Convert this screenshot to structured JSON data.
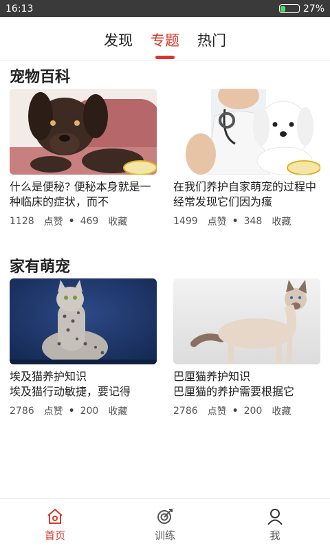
{
  "status_bar": {
    "time": "16:13",
    "battery": "27%",
    "battery_level": 0.27
  },
  "tabs": [
    {
      "label": "发现",
      "active": false
    },
    {
      "label": "专题",
      "active": true
    },
    {
      "label": "热门",
      "active": false
    }
  ],
  "sections": [
    {
      "title": "宠物百科",
      "cards": [
        {
          "image": "brown-dog-on-cushion",
          "text": "什么是便秘? 便秘本身就是一种临床的症状，而不",
          "likes": "1128",
          "like_label": "点赞",
          "favorites": "469",
          "fav_label": "收藏"
        },
        {
          "image": "vet-with-white-puppy",
          "text": "在我们养护自家萌宠的过程中经常发现它们因为瘙",
          "likes": "1499",
          "like_label": "点赞",
          "favorites": "348",
          "fav_label": "收藏"
        }
      ]
    },
    {
      "title": "家有萌宠",
      "cards": [
        {
          "image": "egyptian-mau-cat",
          "text": "埃及猫养护知识\n埃及猫行动敏捷，要记得",
          "likes": "2786",
          "like_label": "点赞",
          "favorites": "200",
          "fav_label": "收藏"
        },
        {
          "image": "balinese-cat",
          "text": "巴厘猫养护知识\n巴厘猫的养护需要根据它",
          "likes": "2786",
          "like_label": "点赞",
          "favorites": "200",
          "fav_label": "收藏"
        }
      ]
    }
  ],
  "bottom_nav": [
    {
      "label": "首页",
      "icon": "home-icon",
      "active": true
    },
    {
      "label": "训练",
      "icon": "target-icon",
      "active": false
    },
    {
      "label": "我",
      "icon": "user-icon",
      "active": false
    }
  ],
  "colors": {
    "accent": "#d9362a",
    "status_bar": "#3a3a3a",
    "battery_fill": "#4cd964"
  }
}
